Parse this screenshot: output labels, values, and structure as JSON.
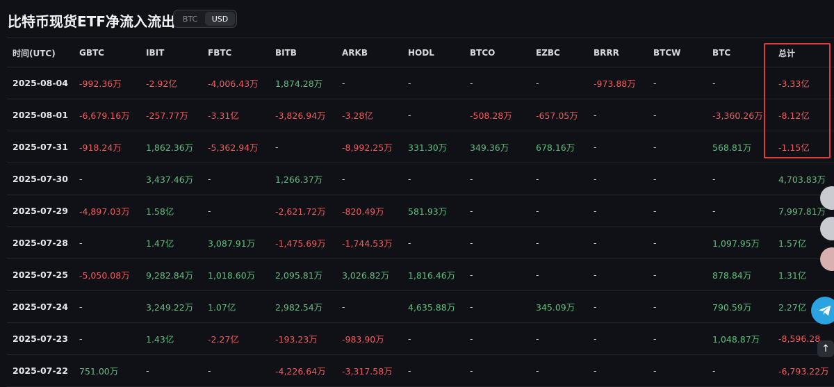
{
  "header": {
    "title": "比特币现货ETF净流入流出",
    "toggle": [
      "BTC",
      "USD"
    ],
    "toggle_active": "USD"
  },
  "table": {
    "columns": [
      "时间(UTC)",
      "GBTC",
      "IBIT",
      "FBTC",
      "BITB",
      "ARKB",
      "HODL",
      "BTCO",
      "EZBC",
      "BRRR",
      "BTCW",
      "BTC",
      "总计"
    ],
    "rows": [
      [
        "2025-08-04",
        "-992.36万",
        "-2.92亿",
        "-4,006.43万",
        "1,874.28万",
        "-",
        "-",
        "-",
        "-",
        "-973.88万",
        "-",
        "-",
        "-3.33亿"
      ],
      [
        "2025-08-01",
        "-6,679.16万",
        "-257.77万",
        "-3.31亿",
        "-3,826.94万",
        "-3.28亿",
        "-",
        "-508.28万",
        "-657.05万",
        "-",
        "-",
        "-3,360.26万",
        "-8.12亿"
      ],
      [
        "2025-07-31",
        "-918.24万",
        "1,862.36万",
        "-5,362.94万",
        "-",
        "-8,992.25万",
        "331.30万",
        "349.36万",
        "678.16万",
        "-",
        "-",
        "568.81万",
        "-1.15亿"
      ],
      [
        "2025-07-30",
        "-",
        "3,437.46万",
        "-",
        "1,266.37万",
        "-",
        "-",
        "-",
        "-",
        "-",
        "-",
        "-",
        "4,703.83万"
      ],
      [
        "2025-07-29",
        "-4,897.03万",
        "1.58亿",
        "-",
        "-2,621.72万",
        "-820.49万",
        "581.93万",
        "-",
        "-",
        "-",
        "-",
        "-",
        "7,997.81万"
      ],
      [
        "2025-07-28",
        "-",
        "1.47亿",
        "3,087.91万",
        "-1,475.69万",
        "-1,744.53万",
        "-",
        "-",
        "-",
        "-",
        "-",
        "1,097.95万",
        "1.57亿"
      ],
      [
        "2025-07-25",
        "-5,050.08万",
        "9,282.84万",
        "1,018.60万",
        "2,095.81万",
        "3,026.82万",
        "1,816.46万",
        "-",
        "-",
        "-",
        "-",
        "878.84万",
        "1.31亿"
      ],
      [
        "2025-07-24",
        "-",
        "3,249.22万",
        "1.07亿",
        "2,982.54万",
        "-",
        "4,635.88万",
        "-",
        "345.09万",
        "-",
        "-",
        "790.59万",
        "2.27亿"
      ],
      [
        "2025-07-23",
        "-",
        "1.43亿",
        "-2.27亿",
        "-193.23万",
        "-983.90万",
        "-",
        "-",
        "-",
        "-",
        "-",
        "1,048.87万",
        "-8,596.28"
      ],
      [
        "2025-07-22",
        "751.00万",
        "-",
        "-",
        "-4,226.64万",
        "-3,317.58万",
        "-",
        "-",
        "-",
        "-",
        "-",
        "-",
        "-6,793.22万"
      ]
    ]
  },
  "colors": {
    "negative": "#f05d5e",
    "positive": "#5fbf7f",
    "highlight": "#e03c3c"
  },
  "icons": {
    "telegram": "telegram-icon",
    "scroll_top": "arrow-up-icon"
  }
}
